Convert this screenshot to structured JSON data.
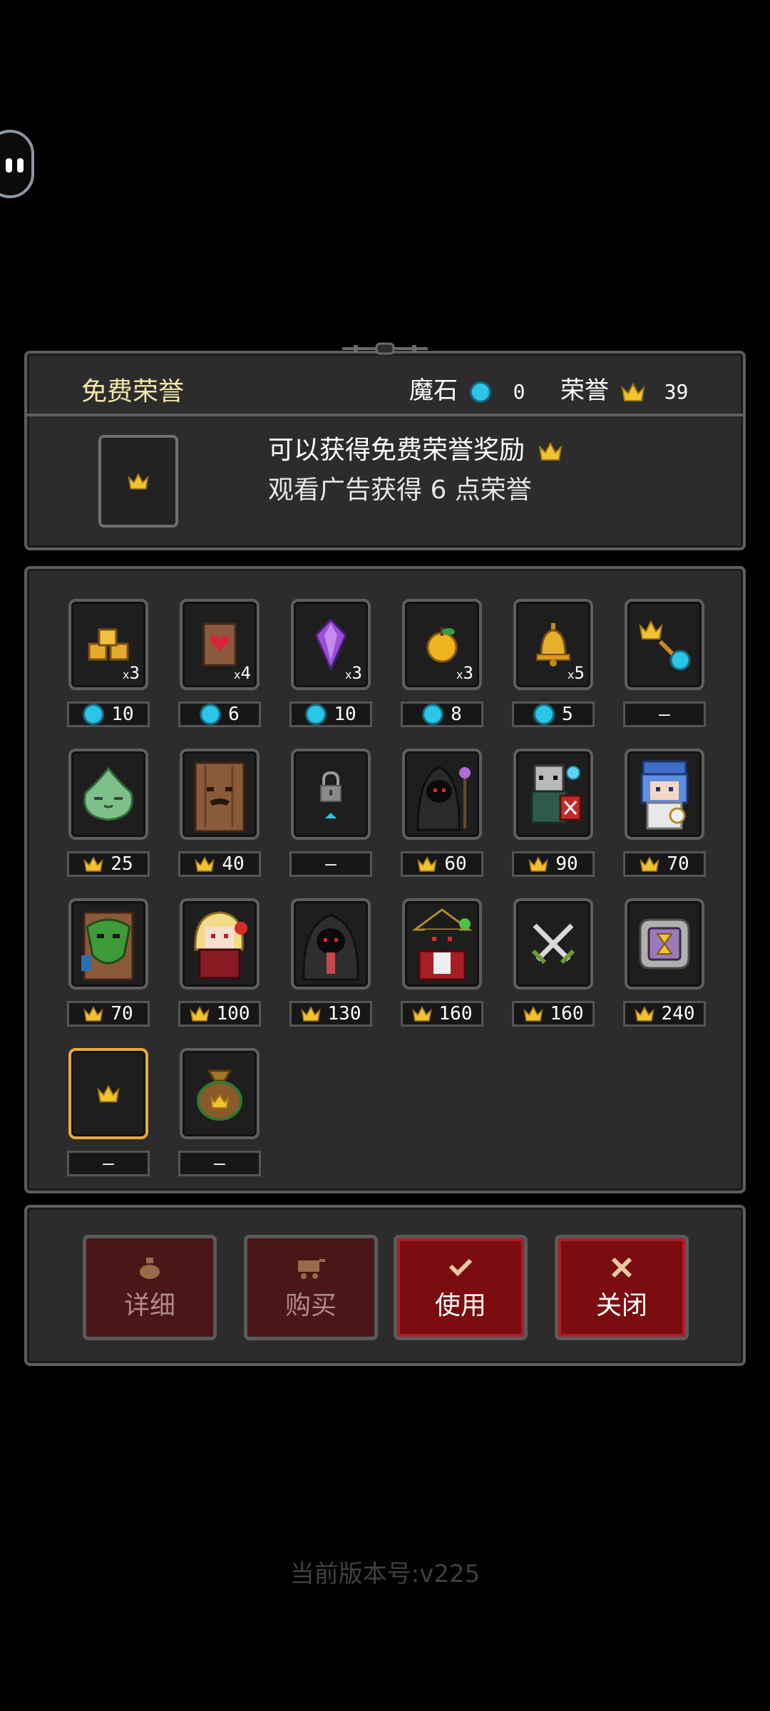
{
  "header": {
    "title": "免费荣誉",
    "gem_label": "魔石",
    "gem_value": "0",
    "honor_label": "荣誉",
    "honor_value": "39"
  },
  "free_reward": {
    "line1": "可以获得免费荣誉奖励",
    "line2": "观看广告获得 6 点荣誉"
  },
  "items_row1": [
    {
      "name": "gold-bars",
      "qty": "3",
      "price": "10",
      "currency": "gem"
    },
    {
      "name": "heart-scroll",
      "qty": "4",
      "price": "6",
      "currency": "gem"
    },
    {
      "name": "purple-crystal",
      "qty": "3",
      "price": "10",
      "currency": "gem"
    },
    {
      "name": "golden-apple",
      "qty": "3",
      "price": "8",
      "currency": "gem"
    },
    {
      "name": "bell",
      "qty": "5",
      "price": "5",
      "currency": "gem"
    },
    {
      "name": "crown-to-gem",
      "qty": "",
      "price": "—",
      "currency": "none"
    }
  ],
  "items_row2": [
    {
      "name": "green-slime",
      "price": "25"
    },
    {
      "name": "tree-monster",
      "price": "40"
    },
    {
      "name": "locked",
      "price": "—"
    },
    {
      "name": "hooded-mage",
      "price": "60"
    },
    {
      "name": "knight-shield",
      "price": "90"
    },
    {
      "name": "blue-priestess",
      "price": "70"
    }
  ],
  "items_row3": [
    {
      "name": "forest-guardian",
      "price": "70"
    },
    {
      "name": "blonde-vampire",
      "price": "100"
    },
    {
      "name": "dark-hood",
      "price": "130"
    },
    {
      "name": "pirate-witch",
      "price": "160"
    },
    {
      "name": "crossed-swords",
      "price": "160"
    },
    {
      "name": "hourglass",
      "price": "240"
    }
  ],
  "items_row4": [
    {
      "name": "crown-selected",
      "price": "—"
    },
    {
      "name": "honor-bag",
      "price": "—"
    }
  ],
  "buttons": {
    "detail": "详细",
    "buy": "购买",
    "use": "使用",
    "close": "关闭"
  },
  "version": "当前版本号:v225",
  "colors": {
    "gem": "#2bc5e8",
    "crown": "#f2c230",
    "selected_border": "#e8a93b",
    "button_active": "#7b0c10"
  }
}
